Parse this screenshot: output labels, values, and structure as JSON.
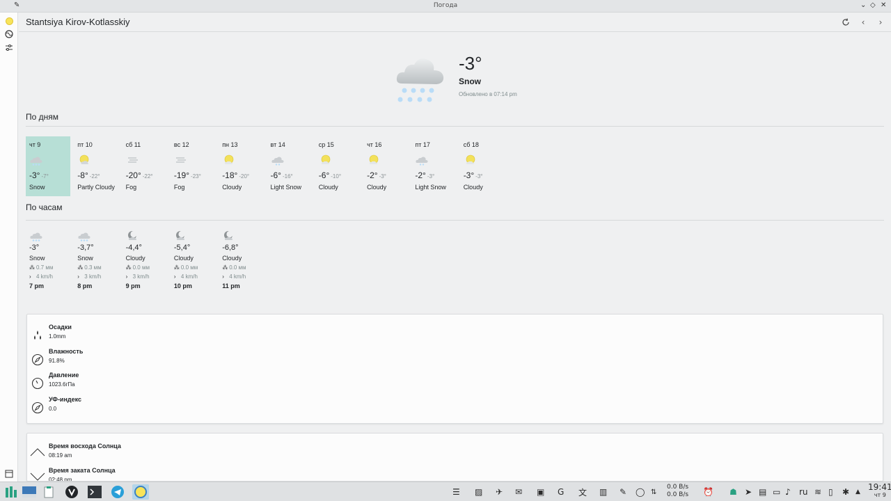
{
  "window": {
    "title": "Погода"
  },
  "header": {
    "location": "Stantsiya Kirov-Kotlasskiy"
  },
  "current": {
    "temp": "-3°",
    "desc": "Snow",
    "updated": "Обновлено в 07:14 pm"
  },
  "daily": {
    "title": "По дням",
    "days": [
      {
        "name": "чт 9",
        "hi": "-3°",
        "lo": "-7°",
        "desc": "Snow",
        "icon": "snow-icon",
        "selected": true
      },
      {
        "name": "пт 10",
        "hi": "-8°",
        "lo": "-22°",
        "desc": "Partly Cloudy",
        "icon": "partly-cloudy-icon"
      },
      {
        "name": "сб 11",
        "hi": "-20°",
        "lo": "-22°",
        "desc": "Fog",
        "icon": "fog-icon"
      },
      {
        "name": "вс 12",
        "hi": "-19°",
        "lo": "-23°",
        "desc": "Fog",
        "icon": "fog-icon"
      },
      {
        "name": "пн 13",
        "hi": "-18°",
        "lo": "-20°",
        "desc": "Cloudy",
        "icon": "sun-cloud-icon"
      },
      {
        "name": "вт 14",
        "hi": "-6°",
        "lo": "-16°",
        "desc": "Light Snow",
        "icon": "light-snow-icon"
      },
      {
        "name": "ср 15",
        "hi": "-6°",
        "lo": "-10°",
        "desc": "Cloudy",
        "icon": "sun-cloud-icon"
      },
      {
        "name": "чт 16",
        "hi": "-2°",
        "lo": "-3°",
        "desc": "Cloudy",
        "icon": "sun-cloud-icon"
      },
      {
        "name": "пт 17",
        "hi": "-2°",
        "lo": "-3°",
        "desc": "Light Snow",
        "icon": "light-snow-icon"
      },
      {
        "name": "сб 18",
        "hi": "-3°",
        "lo": "-3°",
        "desc": "Cloudy",
        "icon": "sun-cloud-icon"
      }
    ]
  },
  "hourly": {
    "title": "По часам",
    "hours": [
      {
        "temp": "-3°",
        "desc": "Snow",
        "precip": "0.7 мм",
        "wind": "4 km/h",
        "time": "7 pm",
        "icon": "snow-icon"
      },
      {
        "temp": "-3,7°",
        "desc": "Snow",
        "precip": "0.3 мм",
        "wind": "3 km/h",
        "time": "8 pm",
        "icon": "snow-icon"
      },
      {
        "temp": "-4,4°",
        "desc": "Cloudy",
        "precip": "0.0 мм",
        "wind": "3 km/h",
        "time": "9 pm",
        "icon": "moon-cloud-icon"
      },
      {
        "temp": "-5,4°",
        "desc": "Cloudy",
        "precip": "0.0 мм",
        "wind": "4 km/h",
        "time": "10 pm",
        "icon": "moon-cloud-icon"
      },
      {
        "temp": "-6,8°",
        "desc": "Cloudy",
        "precip": "0.0 мм",
        "wind": "4 km/h",
        "time": "11 pm",
        "icon": "moon-cloud-icon"
      }
    ]
  },
  "details": [
    {
      "label": "Осадки",
      "value": "1.0mm",
      "icon": "drops-icon"
    },
    {
      "label": "Влажность",
      "value": "91.8%",
      "icon": "compass-icon"
    },
    {
      "label": "Давление",
      "value": "1023.6гПа",
      "icon": "gauge-icon"
    },
    {
      "label": "УФ-индекс",
      "value": "0.0",
      "icon": "compass-icon"
    }
  ],
  "sun": [
    {
      "label": "Время восхода Солнца",
      "value": "08:19 am",
      "icon": "sunrise-icon"
    },
    {
      "label": "Время заката Солнца",
      "value": "02:48 pm",
      "icon": "sunset-icon"
    }
  ],
  "taskbar": {
    "net_down": "0.0 B/s",
    "net_up": "0.0 B/s",
    "lang": "ru",
    "time": "19:41",
    "date": "чт 9"
  }
}
